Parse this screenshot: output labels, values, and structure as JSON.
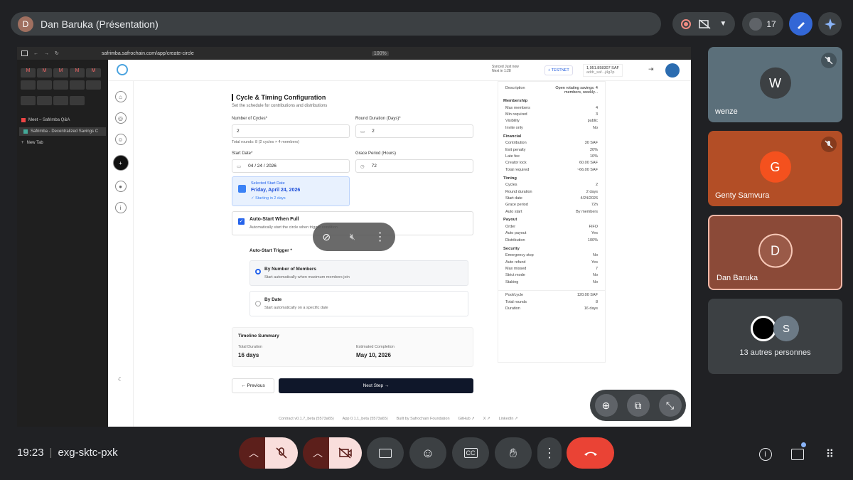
{
  "top": {
    "presenter_initial": "D",
    "presenter_label": "Dan Baruka (Présentation)",
    "participant_count": "17"
  },
  "browser": {
    "url": "safrimba.safrochain.com/app/create-circle",
    "zoom": "100%"
  },
  "tabs": {
    "item1": "Meet – Safrimba Q&A",
    "item2": "Safrimba - Decentralized Savings C",
    "new_tab": "New Tab"
  },
  "apphead": {
    "sync_title": "Synced Just now",
    "sync_sub": "Next in 1:28",
    "network": "+ TESTNET",
    "balance": "1,951.858307 SAF",
    "address": "addr_saf...j4g2p"
  },
  "form": {
    "title": "Cycle & Timing Configuration",
    "subtitle": "Set the schedule for contributions and distributions",
    "cycles_label": "Number of Cycles*",
    "cycles_value": "2",
    "cycles_hint": "Total rounds: 8 (2 cycles × 4 members)",
    "round_label": "Round Duration (Days)*",
    "round_value": "2",
    "start_label": "Start Date*",
    "start_value": "04 / 24 / 2026",
    "grace_label": "Grace Period (Hours)",
    "grace_value": "72",
    "selected_title": "Selected Start Date",
    "selected_date": "Friday, April 24, 2026",
    "selected_hint": "✓ Starting in 2 days",
    "autostart_title": "Auto-Start When Full",
    "autostart_desc": "Automatically start the circle when trigger condition",
    "trigger_label": "Auto-Start Trigger *",
    "opt1_title": "By Number of Members",
    "opt1_desc": "Start automatically when maximum members join",
    "opt2_title": "By Date",
    "opt2_desc": "Start automatically on a specific date",
    "timeline_title": "Timeline Summary",
    "total_label": "Total Duration",
    "total_value": "16 days",
    "completion_label": "Estimated Completion",
    "completion_value": "May 10, 2026",
    "prev": "← Previous",
    "next": "Next Step →"
  },
  "summary": {
    "desc_label": "Description",
    "desc_value": "Open rotating savings: 4 members, weekly...",
    "membership": "Membership",
    "max_members": [
      "Max members",
      "4"
    ],
    "min_required": [
      "Min required",
      "3"
    ],
    "visibility": [
      "Visibility",
      "public"
    ],
    "invite": [
      "Invite only",
      "No"
    ],
    "financial": "Financial",
    "contribution": [
      "Contribution",
      "30 SAF"
    ],
    "exit_penalty": [
      "Exit penalty",
      "20%"
    ],
    "late_fee": [
      "Late fee",
      "10%"
    ],
    "creator_lock": [
      "Creator lock",
      "60.00 SAF"
    ],
    "total_required": [
      "Total required",
      "~66.00 SAF"
    ],
    "timing": "Timing",
    "t_cycles": [
      "Cycles",
      "2"
    ],
    "t_round": [
      "Round duration",
      "2 days"
    ],
    "t_start": [
      "Start date",
      "4/24/2026"
    ],
    "t_grace": [
      "Grace period",
      "72h"
    ],
    "t_auto": [
      "Auto start",
      "By members"
    ],
    "payout": "Payout",
    "p_order": [
      "Order",
      "FIFO"
    ],
    "p_auto": [
      "Auto payout",
      "Yes"
    ],
    "p_dist": [
      "Distribution",
      "100%"
    ],
    "security": "Security",
    "s_emerg": [
      "Emergency stop",
      "No"
    ],
    "s_refund": [
      "Auto refund",
      "Yes"
    ],
    "s_missed": [
      "Max missed",
      "7"
    ],
    "s_strict": [
      "Strict mode",
      "No"
    ],
    "s_staking": [
      "Staking",
      "No"
    ],
    "pool": [
      "Pool/cycle",
      "120.00 SAF"
    ],
    "rounds": [
      "Total rounds",
      "8"
    ],
    "duration": [
      "Duration",
      "16 days"
    ]
  },
  "footer": {
    "contract": "Contract v0.1.7_beta (5573a65)",
    "app": "App 0.1.1_beta (5573a65)",
    "built": "Built by Safrochain Foundation",
    "github": "GitHub ↗",
    "x": "X ↗",
    "linkedin": "LinkedIn ↗"
  },
  "tiles": {
    "t1_initial": "W",
    "t1_name": "wenze",
    "t2_initial": "G",
    "t2_name": "Genty Samvura",
    "t3_initial": "D",
    "t3_name": "Dan Baruka",
    "t4_initial": "S",
    "t4_name": "13 autres personnes"
  },
  "bottom": {
    "time": "19:23",
    "meeting_code": "exg-sktc-pxk"
  },
  "colors": {
    "end_call": "#ea4335",
    "muted_bg": "#f9dedc",
    "muted_arrow_bg": "#5c1f1b",
    "accent": "#1a73e8"
  }
}
